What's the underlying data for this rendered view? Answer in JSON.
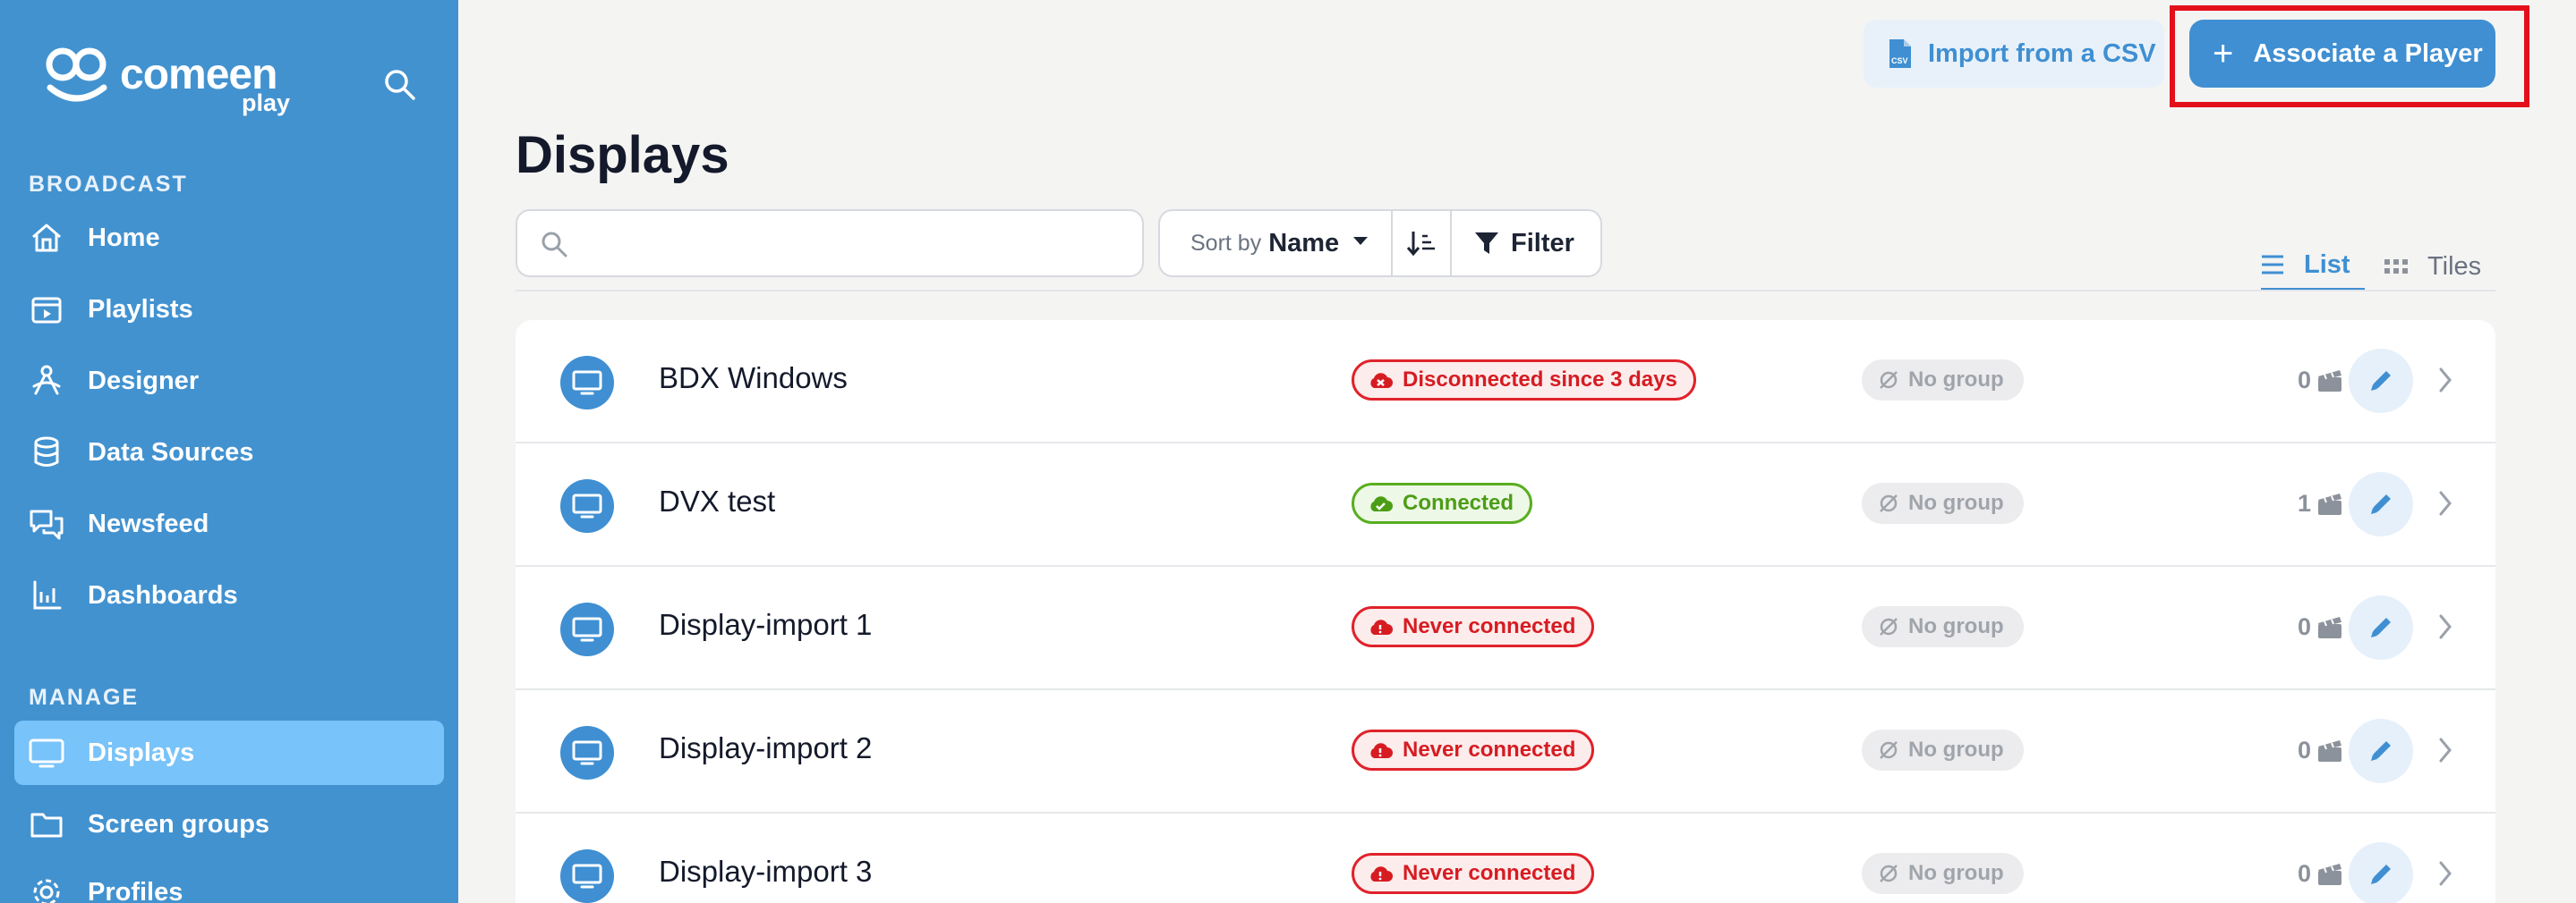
{
  "app": {
    "logo_text": "comeen",
    "logo_sub": "play"
  },
  "sidebar": {
    "sections": [
      {
        "label": "BROADCAST",
        "items": [
          {
            "label": "Home",
            "icon": "home-icon"
          },
          {
            "label": "Playlists",
            "icon": "playlist-icon"
          },
          {
            "label": "Designer",
            "icon": "designer-icon"
          },
          {
            "label": "Data Sources",
            "icon": "database-icon"
          },
          {
            "label": "Newsfeed",
            "icon": "chat-icon"
          },
          {
            "label": "Dashboards",
            "icon": "chart-icon"
          }
        ]
      },
      {
        "label": "MANAGE",
        "items": [
          {
            "label": "Displays",
            "icon": "monitor-icon",
            "active": true
          },
          {
            "label": "Screen groups",
            "icon": "folder-icon"
          },
          {
            "label": "Profiles",
            "icon": "gear-icon"
          }
        ]
      }
    ]
  },
  "header": {
    "import_label": "Import from a CSV",
    "associate_label": "Associate a Player",
    "highlight_color": "#e3101b"
  },
  "page": {
    "title": "Displays"
  },
  "toolbar": {
    "search_placeholder": "",
    "search_value": "",
    "sort_prefix": "Sort by",
    "sort_value": "Name",
    "filter_label": "Filter",
    "view_list_label": "List",
    "view_tiles_label": "Tiles",
    "active_view": "List"
  },
  "displays": [
    {
      "name": "BDX Windows",
      "status": "Disconnected since 3 days",
      "status_type": "disconnected",
      "group": "No group",
      "count": "0"
    },
    {
      "name": "DVX test",
      "status": "Connected",
      "status_type": "connected",
      "group": "No group",
      "count": "1"
    },
    {
      "name": "Display-import 1",
      "status": "Never connected",
      "status_type": "never",
      "group": "No group",
      "count": "0"
    },
    {
      "name": "Display-import 2",
      "status": "Never connected",
      "status_type": "never",
      "group": "No group",
      "count": "0"
    },
    {
      "name": "Display-import 3",
      "status": "Never connected",
      "status_type": "never",
      "group": "No group",
      "count": "0"
    }
  ],
  "colors": {
    "sidebar_bg": "#4292d0",
    "sidebar_active": "#78c3f9",
    "accent": "#3f8fd2",
    "status_bad": "#e0222a",
    "status_good": "#58ae1f"
  }
}
